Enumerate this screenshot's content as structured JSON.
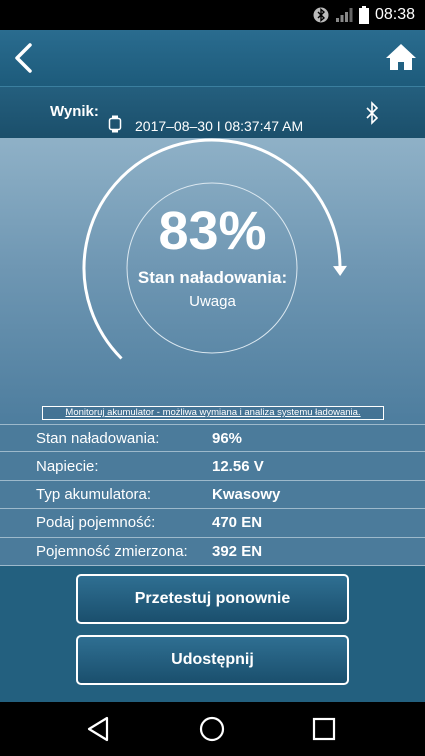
{
  "status_bar": {
    "time": "08:38",
    "icons": [
      "bluetooth-icon",
      "signal-icon",
      "battery-icon"
    ]
  },
  "app_bar": {
    "icons": [
      "back-arrow-icon",
      "home-icon"
    ]
  },
  "result": {
    "label": "Wynik:",
    "datetime": "2017–08–30 I 08:37:47 AM",
    "icons": [
      "watch-icon",
      "bluetooth-icon"
    ]
  },
  "gauge": {
    "percent_label": "83%",
    "percent_value": 0.83,
    "state_label": "Stan naładowania:",
    "state_value": "Uwaga"
  },
  "note": "Monitoruj akumulator - możliwa wymiana i analiza systemu ładowania.",
  "details": [
    {
      "label": "Stan naładowania:",
      "value": "96%"
    },
    {
      "label": "Napiecie:",
      "value": "12.56 V"
    },
    {
      "label": "Typ akumulatora:",
      "value": "Kwasowy"
    },
    {
      "label": "Podaj pojemność:",
      "value": "470 EN"
    },
    {
      "label": "Pojemność zmierzona:",
      "value": "392 EN"
    }
  ],
  "buttons": {
    "retest": "Przetestuj ponownie",
    "share": "Udostępnij"
  },
  "nav_bar": {
    "icons": [
      "nav-back-icon",
      "nav-home-icon",
      "nav-recents-icon"
    ]
  },
  "colors": {
    "primary": "#23607f",
    "gauge_top": "#8fb1c7",
    "gauge_bottom": "#4d7d9e"
  }
}
